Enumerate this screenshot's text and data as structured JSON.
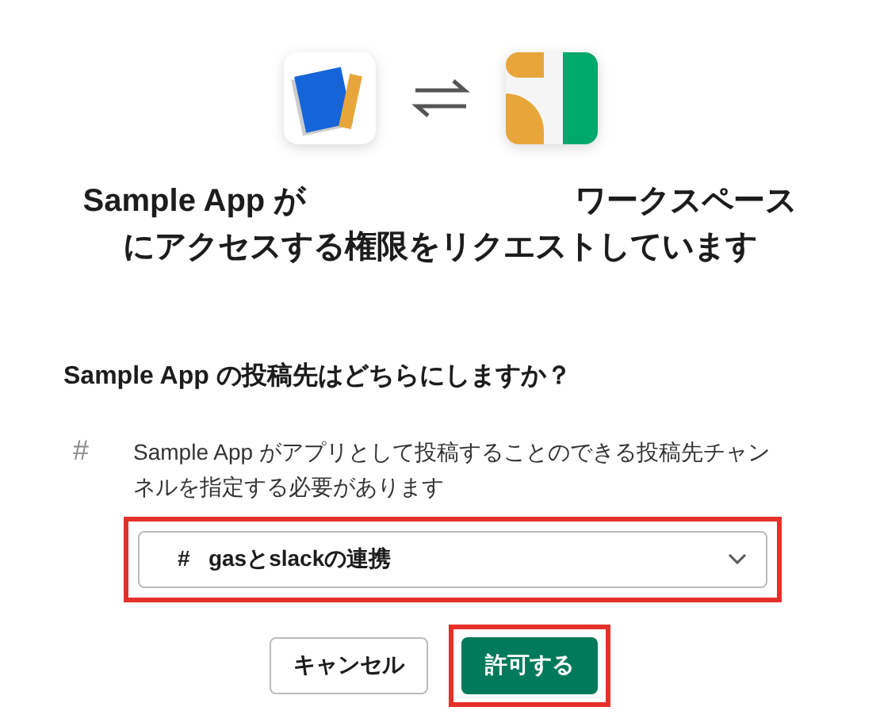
{
  "heading": {
    "line_1_start": "Sample App が",
    "line_1_end": "ワークスペース",
    "line_2": "にアクセスする権限をリクエストしています"
  },
  "question": "Sample App の投稿先はどちらにしますか？",
  "channel_hint": {
    "symbol": "#",
    "text": "Sample App がアプリとして投稿することのできる投稿先チャンネルを指定する必要があります"
  },
  "channel_select": {
    "symbol": "#",
    "value": "gasとslackの連携",
    "highlighted": true
  },
  "buttons": [
    {
      "label": "キャンセル",
      "kind": "secondary",
      "highlighted": false
    },
    {
      "label": "許可する",
      "kind": "primary",
      "highlighted": true
    }
  ]
}
